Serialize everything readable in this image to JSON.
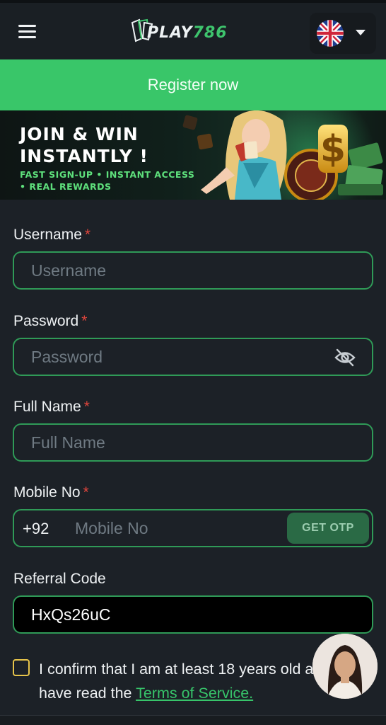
{
  "header": {
    "logo_text": "PLAY",
    "logo_number": "786",
    "language_flag": "uk-flag-icon"
  },
  "register_bar": {
    "label": "Register now"
  },
  "banner": {
    "title_line1": "JOIN & WIN",
    "title_line2": "INSTANTLY !",
    "sub_line1": "FAST SIGN-UP • INSTANT ACCESS",
    "sub_line2": "• REAL REWARDS"
  },
  "form": {
    "username": {
      "label": "Username",
      "required_mark": "*",
      "placeholder": "Username",
      "value": ""
    },
    "password": {
      "label": "Password",
      "required_mark": "*",
      "placeholder": "Password",
      "value": ""
    },
    "full_name": {
      "label": "Full Name",
      "required_mark": "*",
      "placeholder": "Full Name",
      "value": ""
    },
    "mobile": {
      "label": "Mobile No",
      "required_mark": "*",
      "prefix": "+92",
      "placeholder": "Mobile No",
      "value": "",
      "otp_label": "GET OTP"
    },
    "referral": {
      "label": "Referral Code",
      "value": "HxQs26uC"
    }
  },
  "terms": {
    "text_line1": "I confirm that I am at least 18 years old and",
    "text_line2": "have read the ",
    "link": "Terms of Service."
  },
  "colors": {
    "accent": "#39c669",
    "field_border": "#2f9a57",
    "background": "#1c2127",
    "required": "#e0453c",
    "checkbox": "#e7c44a"
  }
}
